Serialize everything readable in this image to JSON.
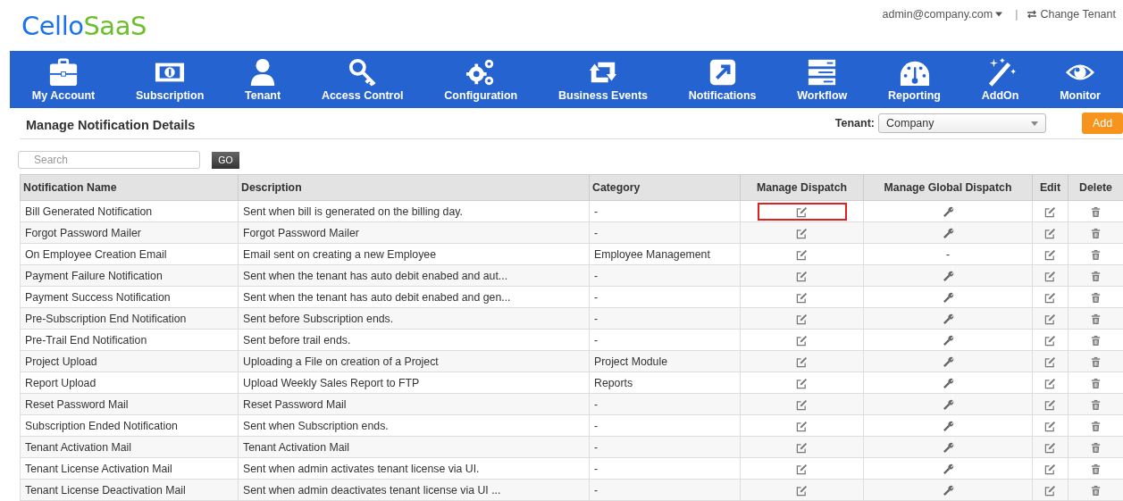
{
  "logo": {
    "part_1": "Cello",
    "part_2": "SaaS"
  },
  "header": {
    "user": "admin@company.com",
    "separator": "|",
    "change_tenant": "Change Tenant"
  },
  "nav": [
    {
      "label": "My Account"
    },
    {
      "label": "Subscription"
    },
    {
      "label": "Tenant"
    },
    {
      "label": "Access Control"
    },
    {
      "label": "Configuration"
    },
    {
      "label": "Business Events"
    },
    {
      "label": "Notifications"
    },
    {
      "label": "Workflow"
    },
    {
      "label": "Reporting"
    },
    {
      "label": "AddOn"
    },
    {
      "label": "Monitor"
    }
  ],
  "page_title": "Manage Notification Details",
  "tenant": {
    "label": "Tenant:",
    "value": "Company"
  },
  "add_button": "Add",
  "search": {
    "placeholder": "Search",
    "button": "GO"
  },
  "table": {
    "columns": [
      "Notification Name",
      "Description",
      "Category",
      "Manage Dispatch",
      "Manage Global Dispatch",
      "Edit",
      "Delete"
    ],
    "rows": [
      {
        "name": "Bill Generated Notification",
        "description": "Sent when bill is generated on the billing day.",
        "category": "-",
        "dispatch_highlighted": true
      },
      {
        "name": "Forgot Password Mailer",
        "description": "Forgot Password Mailer",
        "category": "-",
        "dispatch_highlighted": false
      },
      {
        "name": "On Employee Creation Email",
        "description": "Email sent on creating a new Employee",
        "category": "Employee Management",
        "global_dispatch": "-",
        "dispatch_highlighted": false
      },
      {
        "name": "Payment Failure Notification",
        "description": "Sent when the tenant has auto debit enabed and aut...",
        "category": "-",
        "dispatch_highlighted": false
      },
      {
        "name": "Payment Success Notification",
        "description": "Sent when the tenant has auto debit enabed and gen...",
        "category": "-",
        "dispatch_highlighted": false
      },
      {
        "name": "Pre-Subscription End Notification",
        "description": "Sent before Subscription ends.",
        "category": "-",
        "dispatch_highlighted": false
      },
      {
        "name": "Pre-Trail End Notification",
        "description": "Sent before trail ends.",
        "category": "-",
        "dispatch_highlighted": false
      },
      {
        "name": "Project Upload",
        "description": "Uploading a File on creation of a Project",
        "category": "Project Module",
        "dispatch_highlighted": false
      },
      {
        "name": "Report Upload",
        "description": "Upload Weekly Sales Report to FTP",
        "category": "Reports",
        "dispatch_highlighted": false
      },
      {
        "name": "Reset Password Mail",
        "description": "Reset Password Mail",
        "category": "-",
        "dispatch_highlighted": false
      },
      {
        "name": "Subscription Ended Notification",
        "description": "Sent when Subscription ends.",
        "category": "-",
        "dispatch_highlighted": false
      },
      {
        "name": "Tenant Activation Mail",
        "description": "Tenant Activation Mail",
        "category": "-",
        "dispatch_highlighted": false
      },
      {
        "name": "Tenant License Activation Mail",
        "description": "Sent when admin activates tenant license via UI.",
        "category": "-",
        "dispatch_highlighted": false
      },
      {
        "name": "Tenant License Deactivation Mail",
        "description": "Sent when admin deactivates tenant license via UI ...",
        "category": "-",
        "dispatch_highlighted": false
      }
    ]
  }
}
